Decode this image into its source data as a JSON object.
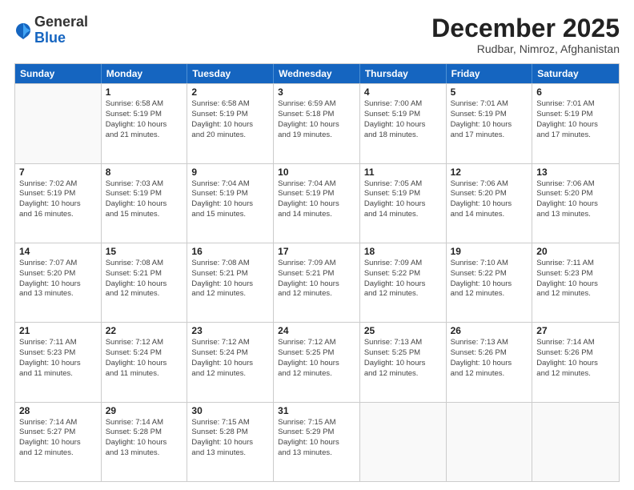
{
  "header": {
    "logo_general": "General",
    "logo_blue": "Blue",
    "month_title": "December 2025",
    "location": "Rudbar, Nimroz, Afghanistan"
  },
  "weekdays": [
    "Sunday",
    "Monday",
    "Tuesday",
    "Wednesday",
    "Thursday",
    "Friday",
    "Saturday"
  ],
  "rows": [
    [
      {
        "day": "",
        "info": ""
      },
      {
        "day": "1",
        "info": "Sunrise: 6:58 AM\nSunset: 5:19 PM\nDaylight: 10 hours\nand 21 minutes."
      },
      {
        "day": "2",
        "info": "Sunrise: 6:58 AM\nSunset: 5:19 PM\nDaylight: 10 hours\nand 20 minutes."
      },
      {
        "day": "3",
        "info": "Sunrise: 6:59 AM\nSunset: 5:18 PM\nDaylight: 10 hours\nand 19 minutes."
      },
      {
        "day": "4",
        "info": "Sunrise: 7:00 AM\nSunset: 5:19 PM\nDaylight: 10 hours\nand 18 minutes."
      },
      {
        "day": "5",
        "info": "Sunrise: 7:01 AM\nSunset: 5:19 PM\nDaylight: 10 hours\nand 17 minutes."
      },
      {
        "day": "6",
        "info": "Sunrise: 7:01 AM\nSunset: 5:19 PM\nDaylight: 10 hours\nand 17 minutes."
      }
    ],
    [
      {
        "day": "7",
        "info": "Sunrise: 7:02 AM\nSunset: 5:19 PM\nDaylight: 10 hours\nand 16 minutes."
      },
      {
        "day": "8",
        "info": "Sunrise: 7:03 AM\nSunset: 5:19 PM\nDaylight: 10 hours\nand 15 minutes."
      },
      {
        "day": "9",
        "info": "Sunrise: 7:04 AM\nSunset: 5:19 PM\nDaylight: 10 hours\nand 15 minutes."
      },
      {
        "day": "10",
        "info": "Sunrise: 7:04 AM\nSunset: 5:19 PM\nDaylight: 10 hours\nand 14 minutes."
      },
      {
        "day": "11",
        "info": "Sunrise: 7:05 AM\nSunset: 5:19 PM\nDaylight: 10 hours\nand 14 minutes."
      },
      {
        "day": "12",
        "info": "Sunrise: 7:06 AM\nSunset: 5:20 PM\nDaylight: 10 hours\nand 14 minutes."
      },
      {
        "day": "13",
        "info": "Sunrise: 7:06 AM\nSunset: 5:20 PM\nDaylight: 10 hours\nand 13 minutes."
      }
    ],
    [
      {
        "day": "14",
        "info": "Sunrise: 7:07 AM\nSunset: 5:20 PM\nDaylight: 10 hours\nand 13 minutes."
      },
      {
        "day": "15",
        "info": "Sunrise: 7:08 AM\nSunset: 5:21 PM\nDaylight: 10 hours\nand 12 minutes."
      },
      {
        "day": "16",
        "info": "Sunrise: 7:08 AM\nSunset: 5:21 PM\nDaylight: 10 hours\nand 12 minutes."
      },
      {
        "day": "17",
        "info": "Sunrise: 7:09 AM\nSunset: 5:21 PM\nDaylight: 10 hours\nand 12 minutes."
      },
      {
        "day": "18",
        "info": "Sunrise: 7:09 AM\nSunset: 5:22 PM\nDaylight: 10 hours\nand 12 minutes."
      },
      {
        "day": "19",
        "info": "Sunrise: 7:10 AM\nSunset: 5:22 PM\nDaylight: 10 hours\nand 12 minutes."
      },
      {
        "day": "20",
        "info": "Sunrise: 7:11 AM\nSunset: 5:23 PM\nDaylight: 10 hours\nand 12 minutes."
      }
    ],
    [
      {
        "day": "21",
        "info": "Sunrise: 7:11 AM\nSunset: 5:23 PM\nDaylight: 10 hours\nand 11 minutes."
      },
      {
        "day": "22",
        "info": "Sunrise: 7:12 AM\nSunset: 5:24 PM\nDaylight: 10 hours\nand 11 minutes."
      },
      {
        "day": "23",
        "info": "Sunrise: 7:12 AM\nSunset: 5:24 PM\nDaylight: 10 hours\nand 12 minutes."
      },
      {
        "day": "24",
        "info": "Sunrise: 7:12 AM\nSunset: 5:25 PM\nDaylight: 10 hours\nand 12 minutes."
      },
      {
        "day": "25",
        "info": "Sunrise: 7:13 AM\nSunset: 5:25 PM\nDaylight: 10 hours\nand 12 minutes."
      },
      {
        "day": "26",
        "info": "Sunrise: 7:13 AM\nSunset: 5:26 PM\nDaylight: 10 hours\nand 12 minutes."
      },
      {
        "day": "27",
        "info": "Sunrise: 7:14 AM\nSunset: 5:26 PM\nDaylight: 10 hours\nand 12 minutes."
      }
    ],
    [
      {
        "day": "28",
        "info": "Sunrise: 7:14 AM\nSunset: 5:27 PM\nDaylight: 10 hours\nand 12 minutes."
      },
      {
        "day": "29",
        "info": "Sunrise: 7:14 AM\nSunset: 5:28 PM\nDaylight: 10 hours\nand 13 minutes."
      },
      {
        "day": "30",
        "info": "Sunrise: 7:15 AM\nSunset: 5:28 PM\nDaylight: 10 hours\nand 13 minutes."
      },
      {
        "day": "31",
        "info": "Sunrise: 7:15 AM\nSunset: 5:29 PM\nDaylight: 10 hours\nand 13 minutes."
      },
      {
        "day": "",
        "info": ""
      },
      {
        "day": "",
        "info": ""
      },
      {
        "day": "",
        "info": ""
      }
    ]
  ]
}
